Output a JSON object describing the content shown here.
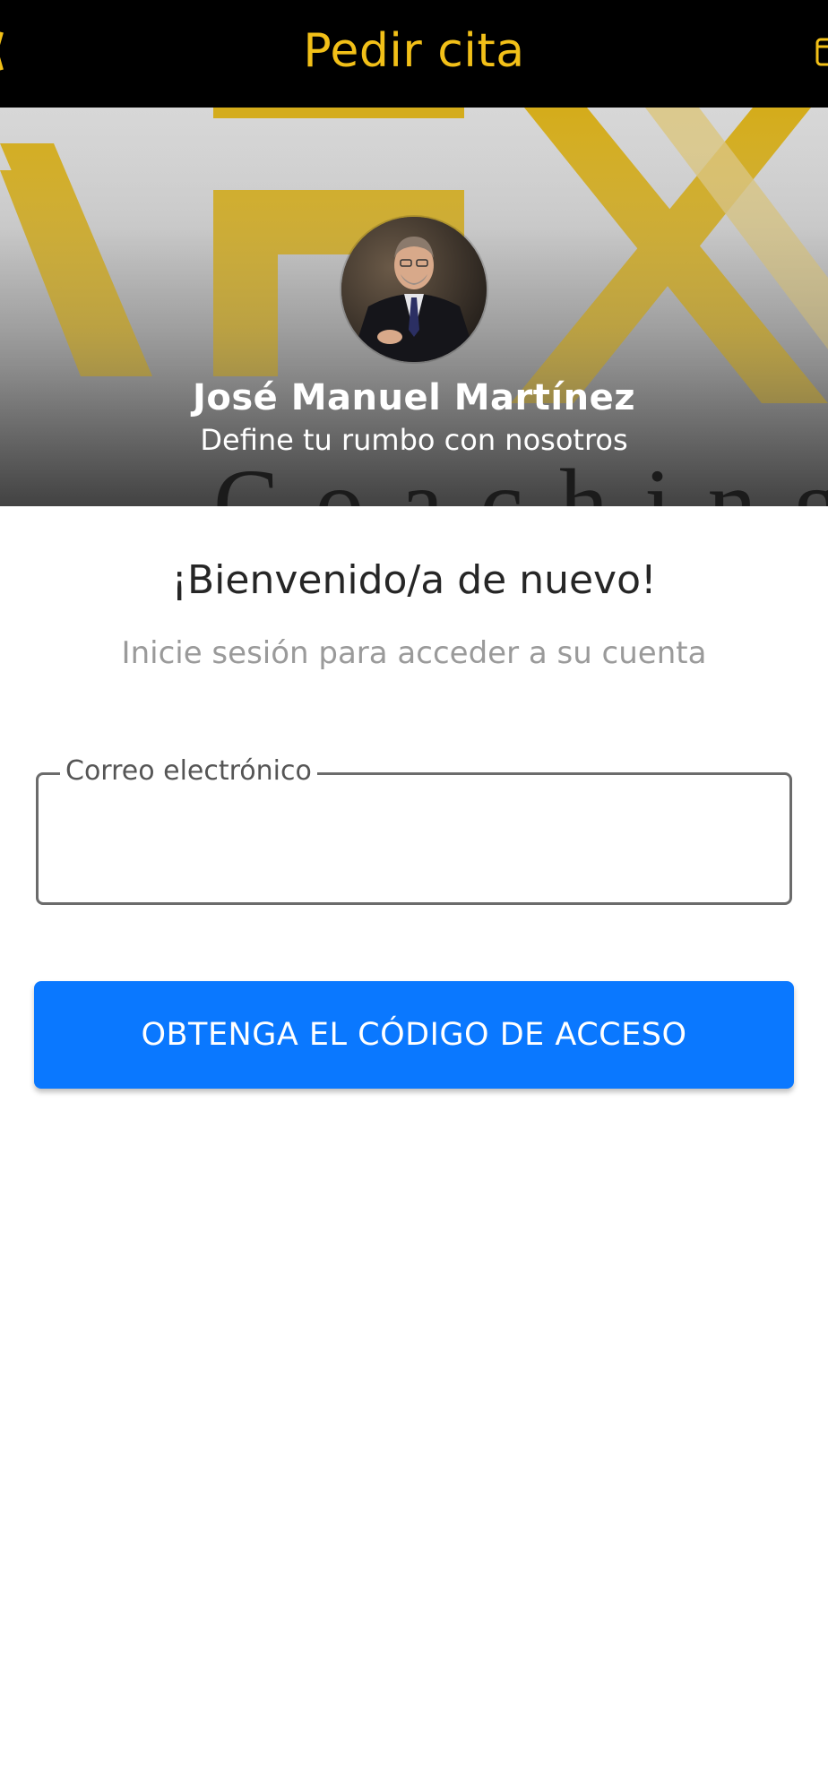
{
  "header": {
    "title": "Pedir cita",
    "right_icon": "calendar-icon"
  },
  "profile": {
    "name": "José Manuel Martínez",
    "tagline": "Define tu rumbo con nosotros",
    "banner_watermark": "Coaching",
    "avatar_icon": "profile-photo"
  },
  "login": {
    "welcome": "¡Bienvenido/a de nuevo!",
    "subtitle": "Inicie sesión para acceder a su cuenta",
    "email_label": "Correo electrónico",
    "email_value": "",
    "email_placeholder": "",
    "submit_label": "OBTENGA EL CÓDIGO DE ACCESO"
  },
  "colors": {
    "header_bg": "#000000",
    "header_text": "#f2c018",
    "brand_yellow": "#d4ac1a",
    "primary_button": "#0a78ff",
    "title_text": "#262626",
    "muted_text": "#9a9a9a"
  }
}
